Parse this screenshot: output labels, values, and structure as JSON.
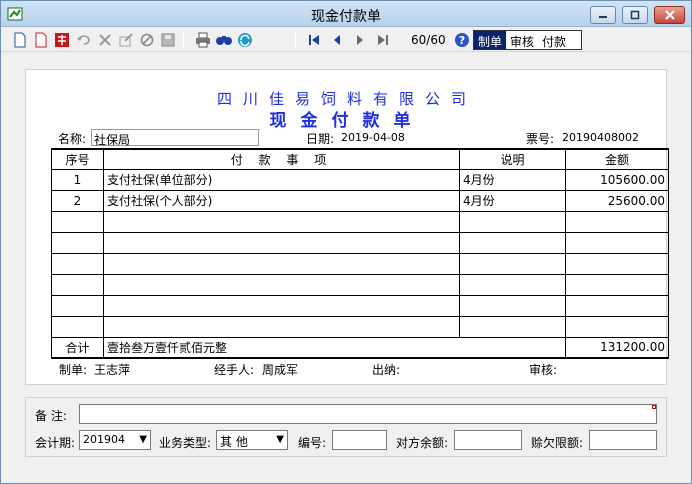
{
  "window": {
    "title": "现金付款单"
  },
  "toolbar": {
    "icons": [
      "new-document-icon",
      "blank-document-icon",
      "red-seal-icon",
      "undo-icon",
      "delete-icon",
      "edit-icon",
      "cancel-icon",
      "save-icon",
      "print-icon",
      "find-icon",
      "refresh-icon",
      "first-record-icon",
      "previous-record-icon",
      "next-record-icon",
      "last-record-icon",
      "help-icon"
    ],
    "page_count": "60/60",
    "modes": [
      "制单",
      "审核",
      "付款"
    ],
    "active_mode": "制单"
  },
  "voucher": {
    "company": "四川佳易饲料有限公司",
    "title": "现金付款单",
    "name_label": "名称:",
    "name_value": "社保局",
    "date_label": "日期:",
    "date_value": "2019-04-08",
    "ticket_label": "票号:",
    "ticket_value": "20190408002",
    "columns": {
      "no": "序号",
      "item": "付 款 事 项",
      "note": "说明",
      "amount": "金额"
    },
    "rows": [
      {
        "no": "1",
        "item": "支付社保(单位部分)",
        "note": "4月份",
        "amount": "105600.00"
      },
      {
        "no": "2",
        "item": "支付社保(个人部分)",
        "note": "4月份",
        "amount": "25600.00"
      },
      {
        "no": "",
        "item": "",
        "note": "",
        "amount": ""
      },
      {
        "no": "",
        "item": "",
        "note": "",
        "amount": ""
      },
      {
        "no": "",
        "item": "",
        "note": "",
        "amount": ""
      },
      {
        "no": "",
        "item": "",
        "note": "",
        "amount": ""
      },
      {
        "no": "",
        "item": "",
        "note": "",
        "amount": ""
      },
      {
        "no": "",
        "item": "",
        "note": "",
        "amount": ""
      }
    ],
    "total_label": "合计",
    "total_words": "壹拾叁万壹仟贰佰元整",
    "total_amount": "131200.00",
    "maker_label": "制单:",
    "maker_value": "王志萍",
    "handler_label": "经手人:",
    "handler_value": "周成军",
    "cashier_label": "出纳:",
    "cashier_value": "",
    "auditor_label": "审核:",
    "auditor_value": ""
  },
  "form": {
    "remark_label": "备 注:",
    "remark_value": "",
    "period_label": "会计期:",
    "period_value": "201904",
    "business_label": "业务类型:",
    "business_value": "其 他",
    "number_label": "编号:",
    "number_value": "",
    "balance_label": "对方余额:",
    "balance_value": "",
    "credit_label": "赊欠限额:",
    "credit_value": ""
  },
  "colors": {
    "title_blue": "#1f2ee0",
    "active_tab": "#0a246a",
    "close_red": "#c9463a"
  }
}
